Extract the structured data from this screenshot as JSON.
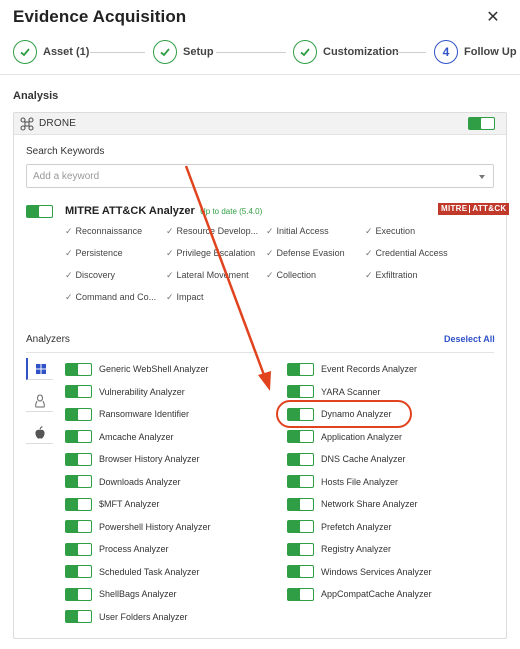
{
  "window": {
    "title": "Evidence Acquisition"
  },
  "stepper": {
    "steps": [
      {
        "label": "Asset (1)",
        "state": "done"
      },
      {
        "label": "Setup",
        "state": "done"
      },
      {
        "label": "Customization",
        "state": "done"
      },
      {
        "label": "Follow Up",
        "state": "current",
        "number": "4"
      }
    ]
  },
  "analysis": {
    "section_label": "Analysis",
    "drone": {
      "label": "DRONE",
      "enabled": true
    },
    "search": {
      "label": "Search Keywords",
      "placeholder": "Add a keyword"
    },
    "mitre": {
      "title": "MITRE ATT&CK Analyzer",
      "status": "Up to date (5.4.0)",
      "logo_left": "MITRE",
      "logo_right": "ATT&CK",
      "enabled": true,
      "tactics": [
        "Reconnaissance",
        "Resource Develop...",
        "Initial Access",
        "Execution",
        "Persistence",
        "Privilege Escalation",
        "Defense Evasion",
        "Credential Access",
        "Discovery",
        "Lateral Movement",
        "Collection",
        "Exfiltration",
        "Command and Co...",
        "Impact"
      ]
    },
    "analyzers": {
      "label": "Analyzers",
      "deselect_label": "Deselect All",
      "os_tabs": [
        "windows-icon",
        "linux-icon",
        "apple-icon"
      ],
      "left": [
        "Generic WebShell Analyzer",
        "Vulnerability Analyzer",
        "Ransomware Identifier",
        "Amcache Analyzer",
        "Browser History Analyzer",
        "Downloads Analyzer",
        "$MFT Analyzer",
        "Powershell History Analyzer",
        "Process Analyzer",
        "Scheduled Task Analyzer",
        "ShellBags Analyzer",
        "User Folders Analyzer"
      ],
      "right": [
        "Event Records Analyzer",
        "YARA Scanner",
        "Dynamo Analyzer",
        "Application Analyzer",
        "DNS Cache Analyzer",
        "Hosts File Analyzer",
        "Network Share Analyzer",
        "Prefetch Analyzer",
        "Registry Analyzer",
        "Windows Services Analyzer",
        "AppCompatCache Analyzer"
      ],
      "highlighted": "Dynamo Analyzer"
    }
  },
  "colors": {
    "accent_green": "#2f9e44",
    "accent_blue": "#2f52c7",
    "annotation_red": "#e0431e",
    "mitre_red": "#c0392b"
  }
}
